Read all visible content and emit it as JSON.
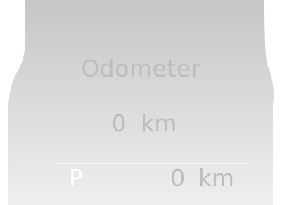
{
  "dashboard": {
    "title": "Odometer",
    "odometer_value": "0 km",
    "gear": "P",
    "trip_value": "0 km"
  },
  "colors": {
    "panel_top": "#c8c8c8",
    "panel_bottom": "#eeeeee",
    "text": "#bdbdbd",
    "gear_text": "#ffffff",
    "divider": "#f7f7f7"
  }
}
